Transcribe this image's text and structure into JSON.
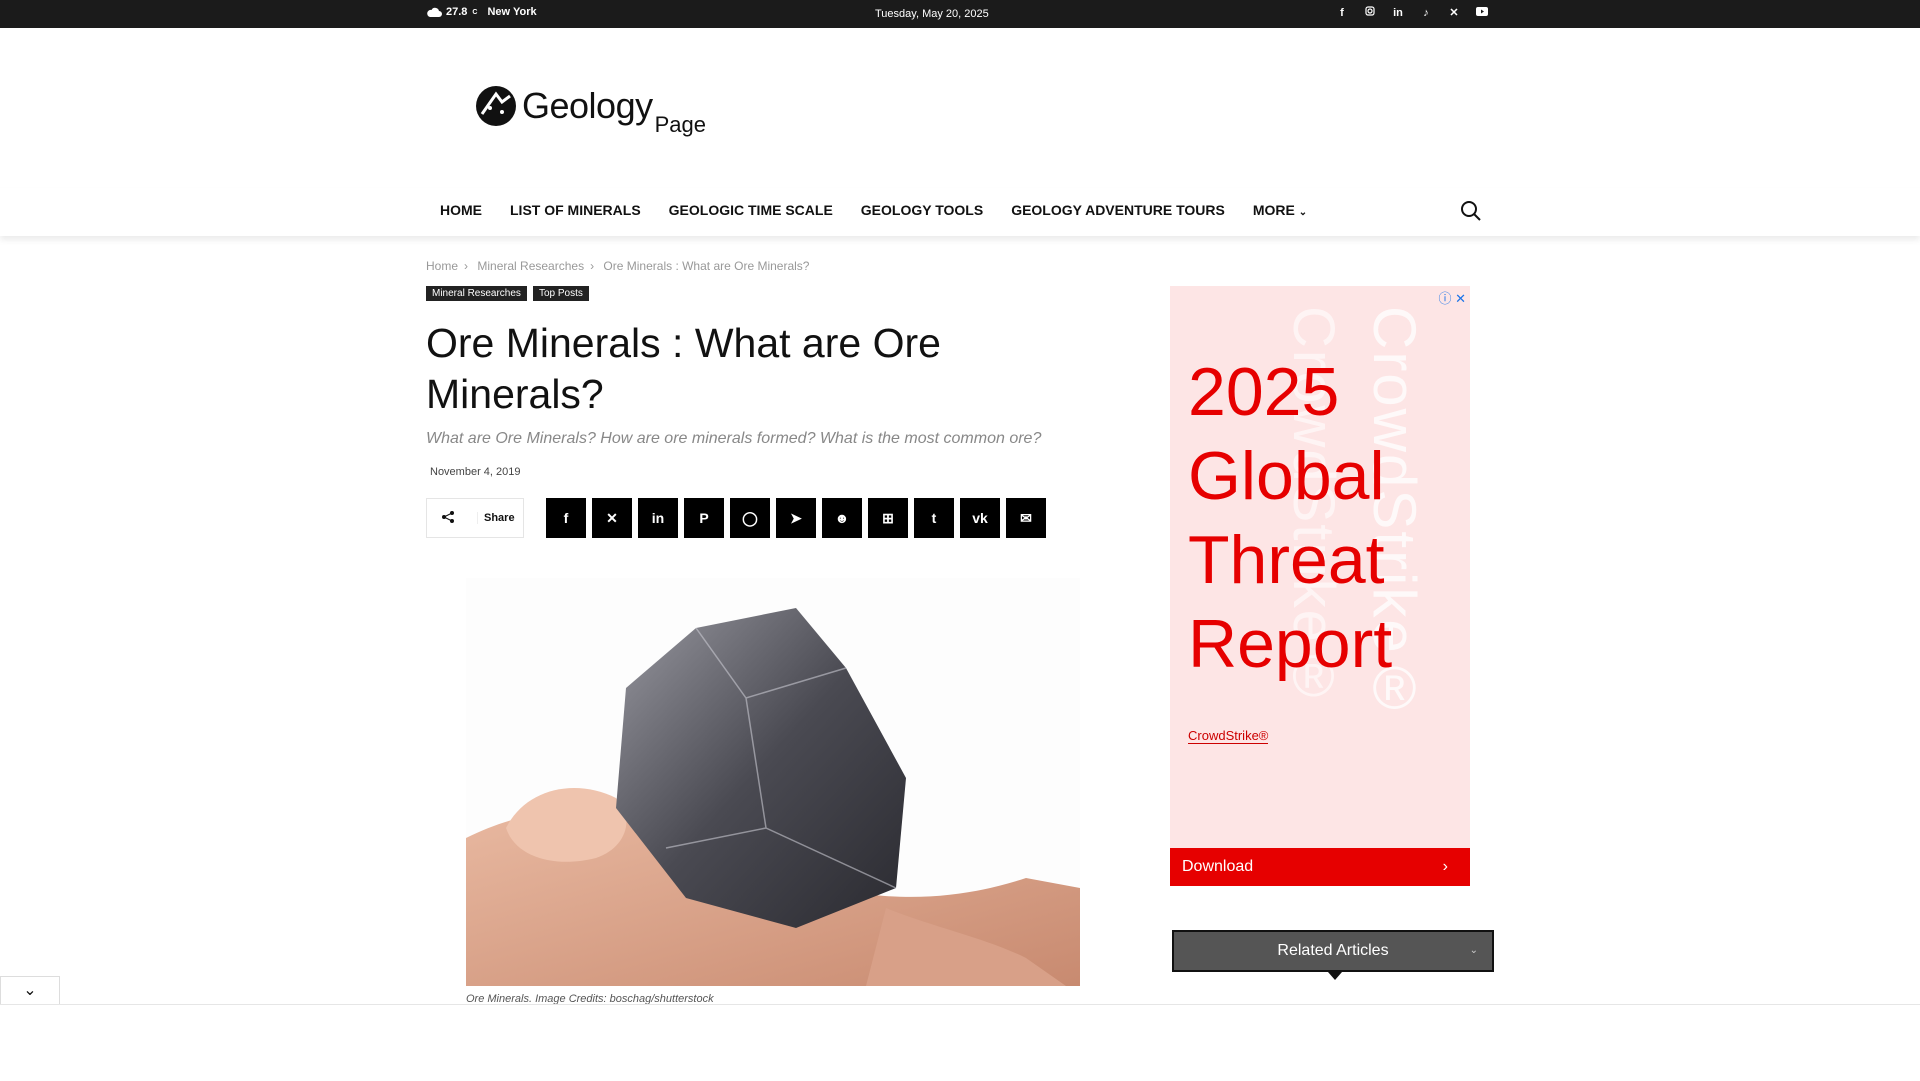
{
  "topbar": {
    "temperature": "27.8",
    "unit": "C",
    "city": "New York",
    "date": "Tuesday, May 20, 2025",
    "social": [
      "facebook-icon",
      "instagram-icon",
      "linkedin-icon",
      "tiktok-icon",
      "x-icon",
      "youtube-icon"
    ]
  },
  "logo": {
    "main": "Geology",
    "sub": "Page"
  },
  "nav": {
    "items": [
      "HOME",
      "LIST OF MINERALS",
      "GEOLOGIC TIME SCALE",
      "GEOLOGY TOOLS",
      "GEOLOGY ADVENTURE TOURS",
      "MORE"
    ]
  },
  "breadcrumb": [
    "Home",
    "Mineral Researches",
    "Ore Minerals : What are Ore Minerals?"
  ],
  "categories": [
    "Mineral Researches",
    "Top Posts"
  ],
  "article": {
    "title": "Ore Minerals : What are Ore Minerals?",
    "subtitle": "What are Ore Minerals? How are ore minerals formed? What is the most common ore?",
    "date": "November 4, 2019",
    "share_label": "Share",
    "caption": "Ore Minerals. Image Credits: boschag/shutterstock"
  },
  "share_icons": [
    "facebook-icon",
    "x-icon",
    "linkedin-icon",
    "pinterest-icon",
    "whatsapp-icon",
    "telegram-icon",
    "reddit-icon",
    "flipboard-icon",
    "tumblr-icon",
    "vk-icon",
    "email-icon"
  ],
  "ad": {
    "headline": "2025 Global Threat Report",
    "brand": "CrowdStrike®",
    "watermark": "CrowdStrike®",
    "cta": "Download"
  },
  "related": {
    "label": "Related Articles"
  },
  "colors": {
    "accent": "#e60000",
    "topbar": "#1b1b1b"
  }
}
